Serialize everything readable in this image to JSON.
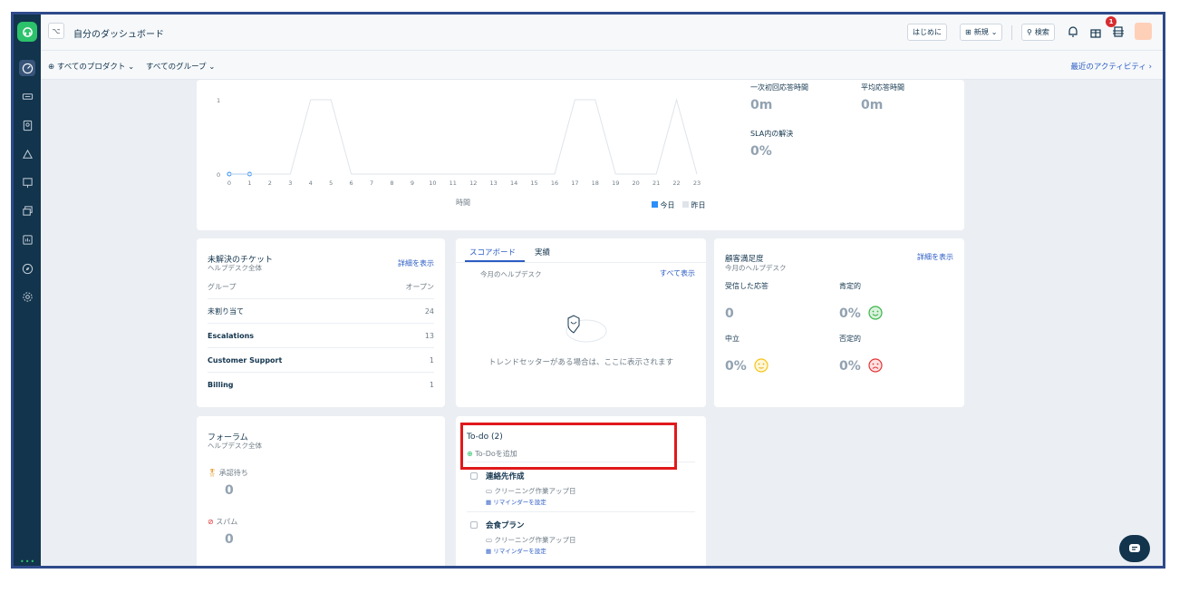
{
  "header": {
    "title": "自分のダッシュボード",
    "getting_started": "はじめに",
    "new_label": "新規",
    "search_label": "検索",
    "notif_count": "1",
    "avatar_initial": "ㅤ"
  },
  "filters": {
    "products": "すべてのプロダクト",
    "groups": "すべてのグループ",
    "recent_activity": "最近のアクティビティ ›"
  },
  "chart": {
    "xlabel": "時間",
    "legend_today": "今日",
    "legend_yesterday": "昨日",
    "ytick_top": "1",
    "ytick_bottom": "0"
  },
  "chart_data": {
    "type": "line",
    "x": [
      0,
      1,
      2,
      3,
      4,
      5,
      6,
      7,
      8,
      9,
      10,
      11,
      12,
      13,
      14,
      15,
      16,
      17,
      18,
      19,
      20,
      21,
      22,
      23
    ],
    "xlabel": "時間",
    "ylabel": "",
    "ylim": [
      0,
      1
    ],
    "series": [
      {
        "name": "今日",
        "values": [
          0,
          0,
          null,
          null,
          null,
          null,
          null,
          null,
          null,
          null,
          null,
          null,
          null,
          null,
          null,
          null,
          null,
          null,
          null,
          null,
          null,
          null,
          null,
          null
        ],
        "color": "#2c8ef8"
      },
      {
        "name": "昨日",
        "values": [
          0,
          0,
          0,
          0,
          1,
          1,
          0,
          0,
          0,
          0,
          0,
          0,
          0,
          0,
          0,
          0,
          0,
          1,
          1,
          0,
          0,
          0,
          1,
          0
        ],
        "color": "#dfe4ea"
      }
    ],
    "grid": false,
    "legend": "bottom-right"
  },
  "metrics": {
    "first_response_label": "一次初回応答時間",
    "first_response_value": "0m",
    "avg_response_label": "平均応答時間",
    "avg_response_value": "0m",
    "sla_label": "SLA内の解決",
    "sla_value": "0%"
  },
  "unresolved": {
    "title": "未解決のチケット",
    "subtitle": "ヘルプデスク全体",
    "link": "詳細を表示",
    "col_group": "グループ",
    "col_open": "オープン",
    "rows": [
      {
        "name": "未割り当て",
        "count": "24"
      },
      {
        "name": "Escalations",
        "count": "13"
      },
      {
        "name": "Customer Support",
        "count": "1"
      },
      {
        "name": "Billing",
        "count": "1"
      }
    ]
  },
  "scoreboard": {
    "tab_score": "スコアボード",
    "tab_perf": "実績",
    "subtitle": "今月のヘルプデスク",
    "link": "すべて表示",
    "empty": "トレンドセッターがある場合は、ここに表示されます"
  },
  "csat": {
    "title": "顧客満足度",
    "subtitle": "今月のヘルプデスク",
    "link": "詳細を表示",
    "received_label": "受信した応答",
    "received_value": "0",
    "positive_label": "肯定的",
    "positive_value": "0%",
    "neutral_label": "中立",
    "neutral_value": "0%",
    "negative_label": "否定的",
    "negative_value": "0%"
  },
  "forum": {
    "title": "フォーラム",
    "subtitle": "ヘルプデスク全体",
    "pending_label": "承認待ち",
    "pending_value": "0",
    "spam_label": "スパム",
    "spam_value": "0"
  },
  "todo": {
    "title": "To-do (2)",
    "add_label": "To-Doを追加",
    "items": [
      {
        "title": "連絡先作成",
        "meta": "クリーニング作業アップ日",
        "reminder": "リマインダーを設定"
      },
      {
        "title": "会食プラン",
        "meta": "クリーニング作業アップ日",
        "reminder": "リマインダーを設定"
      }
    ]
  },
  "colors": {
    "rail": "#12344d",
    "brand": "#2cc26b",
    "link": "#2c5cc5",
    "highlight": "#e0191b"
  }
}
